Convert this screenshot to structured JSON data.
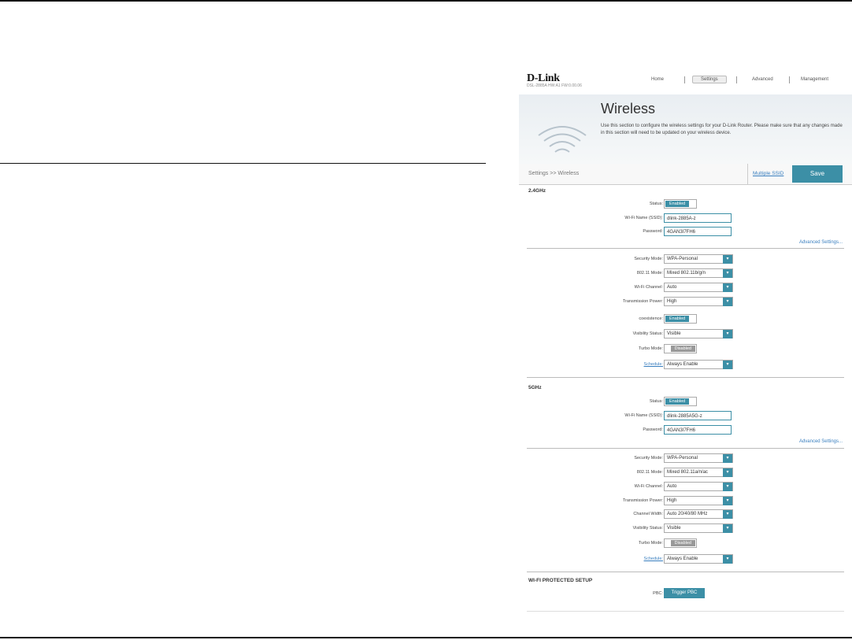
{
  "header": {
    "logo": "D-Link",
    "model": "DSL-2885A   HW:A1   FW:0.00.06",
    "nav": [
      "Home",
      "Settings",
      "Advanced",
      "Management"
    ]
  },
  "banner": {
    "title": "Wireless",
    "description": "Use this section to configure the wireless settings for your D-Link Router. Please make sure that any changes made in this section will need to be updated on your wireless device."
  },
  "breadcrumb": "Settings >> Wireless",
  "multi_ssid_label": "Multiple SSID",
  "save_label": "Save",
  "band24": {
    "title": "2.4GHz",
    "status_label": "Status:",
    "status": "Enabled",
    "ssid_label": "Wi-Fi Name (SSID):",
    "ssid": "dlink-2885A-z",
    "password_label": "Password:",
    "password": "4GAN3I7FH6",
    "advanced_link": "Advanced Settings...",
    "security_label": "Security Mode:",
    "security": "WPA-Personal",
    "mode_label": "802.11 Mode:",
    "mode": "Mixed 802.11b/g/n",
    "channel_label": "Wi-Fi Channel:",
    "channel": "Auto",
    "power_label": "Transmission Power:",
    "power": "High",
    "coexistence_label": "coexistence:",
    "coexistence": "Enabled",
    "visibility_label": "Visibility Status:",
    "visibility": "Visible",
    "turbo_label": "Turbo Mode:",
    "turbo": "Disabled",
    "schedule_label": "Schedule:",
    "schedule": "Always Enable"
  },
  "band5": {
    "title": "5GHz",
    "status_label": "Status:",
    "status": "Enabled",
    "ssid_label": "Wi-Fi Name (SSID):",
    "ssid": "dlink-2885A5G-z",
    "password_label": "Password:",
    "password": "4GAN3I7FH6",
    "advanced_link": "Advanced Settings...",
    "security_label": "Security Mode:",
    "security": "WPA-Personal",
    "mode_label": "802.11 Mode:",
    "mode": "Mixed 802.11a/n/ac",
    "channel_label": "Wi-Fi Channel:",
    "channel": "Auto",
    "power_label": "Transmission Power:",
    "power": "High",
    "width_label": "Channel Width:",
    "width": "Auto 20/40/80 MHz",
    "visibility_label": "Visibility Status:",
    "visibility": "Visible",
    "turbo_label": "Turbo Mode:",
    "turbo": "Disabled",
    "schedule_label": "Schedule:",
    "schedule": "Always Enable"
  },
  "wps": {
    "title": "WI-FI PROTECTED SETUP",
    "pbc_label": "PBC:",
    "pbc_button": "Trigger PBC"
  },
  "colors": {
    "accent": "#3c8fa6",
    "link": "#3a7fbf"
  },
  "icons": {
    "banner": "wifi-icon",
    "dropdown": "chevron-down-icon"
  }
}
